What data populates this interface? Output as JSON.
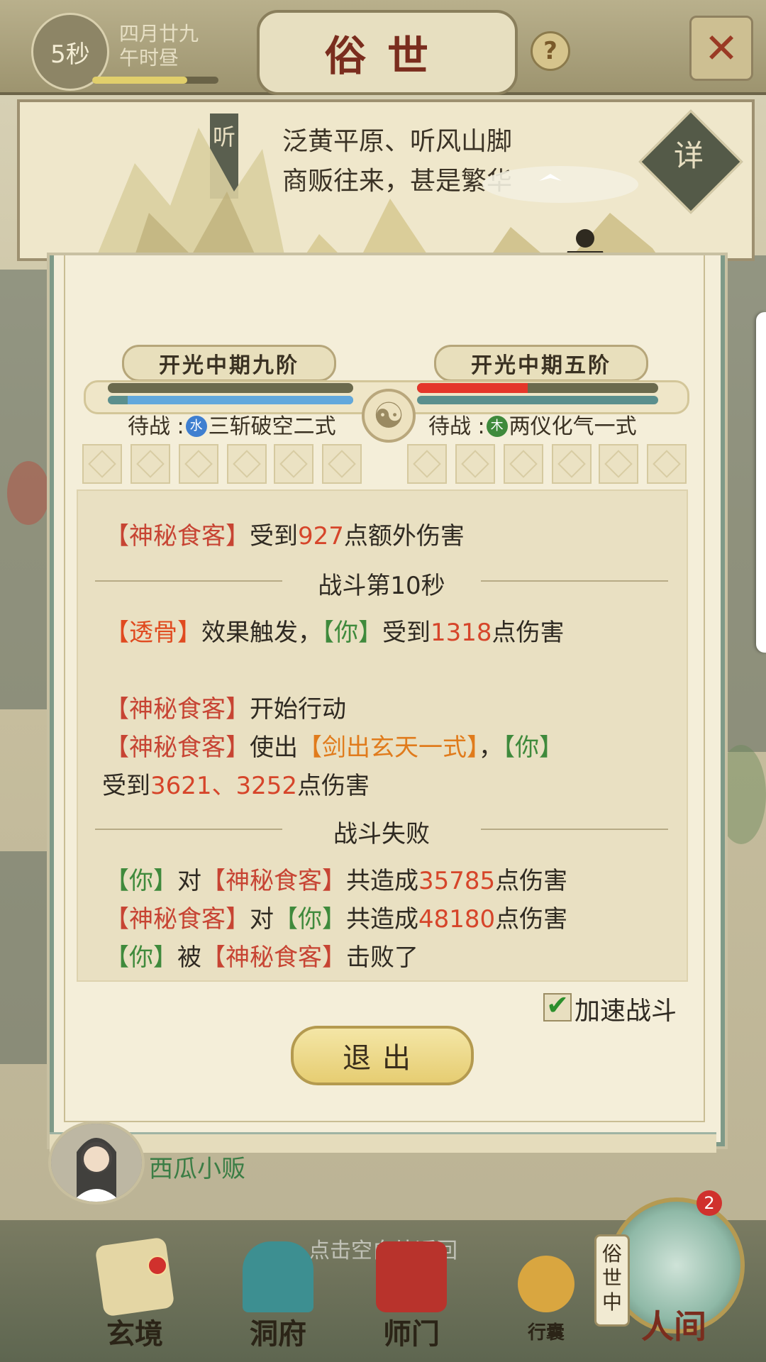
{
  "header": {
    "timer": "5秒",
    "date_line1": "四月廿九",
    "date_line2": "午时昼",
    "title": "俗世",
    "help": "?",
    "close": "✕",
    "day_progress": 0.75
  },
  "location": {
    "line1": "泛黄平原、听风山脚",
    "line2": "商贩往来，甚是繁华",
    "detail_button": "详",
    "sign_text": "听"
  },
  "battle": {
    "player": {
      "realm": "开光中期九阶",
      "hp_fraction": 1.0,
      "mp_fraction": 0.92,
      "standby_label": "待战",
      "element": "水",
      "skill": "三斩破空二式"
    },
    "enemy": {
      "realm": "开光中期五阶",
      "hp_fraction": 0.46,
      "mp_fraction": 1.0,
      "standby_label": "待战",
      "element": "木",
      "skill": "两仪化气一式"
    },
    "colors": {
      "player_hp": "#6b6a4d",
      "enemy_hp": "#e4362a",
      "mp": "#62a8dc",
      "element_water": "#3f7fd0",
      "element_wood": "#3f8a3c"
    }
  },
  "log": {
    "l1": {
      "a": "【神秘食客】",
      "b": "受到",
      "n": "927",
      "c": "点额外伤害"
    },
    "divider1": "战斗第10秒",
    "l2": {
      "a": "【透骨】",
      "b": "效果触发，",
      "c": "【你】",
      "d": "受到",
      "n": "1318",
      "e": "点伤害"
    },
    "l3": {
      "a": "【神秘食客】",
      "b": "开始行动"
    },
    "l4": {
      "a": "【神秘食客】",
      "b": "使出",
      "c": "【剑出玄天一式】",
      "d": "，",
      "e": "【你】"
    },
    "l5": {
      "a": "受到",
      "n1": "3621",
      "s": "、",
      "n2": "3252",
      "b": "点伤害"
    },
    "divider2": "战斗失败",
    "l6": {
      "a": "【你】",
      "b": "对",
      "c": "【神秘食客】",
      "d": "共造成",
      "n": "35785",
      "e": "点伤害"
    },
    "l7": {
      "a": "【神秘食客】",
      "b": "对",
      "c": "【你】",
      "d": "共造成",
      "n": "48180",
      "e": "点伤害"
    },
    "l8": {
      "a": "【你】",
      "b": "被",
      "c": "【神秘食客】",
      "d": "击败了"
    }
  },
  "controls": {
    "speed_check": "✔",
    "speed_label": "加速战斗",
    "exit_label": "退出"
  },
  "background": {
    "vendor_name": "西瓜小贩",
    "back_hint": "点击空白处返回"
  },
  "nav": {
    "items": [
      {
        "label": "玄境"
      },
      {
        "label": "洞府"
      },
      {
        "label": "师门"
      },
      {
        "label": "行囊"
      }
    ],
    "current_tag": "俗世中",
    "current_label": "人间",
    "badge_count": "2"
  }
}
